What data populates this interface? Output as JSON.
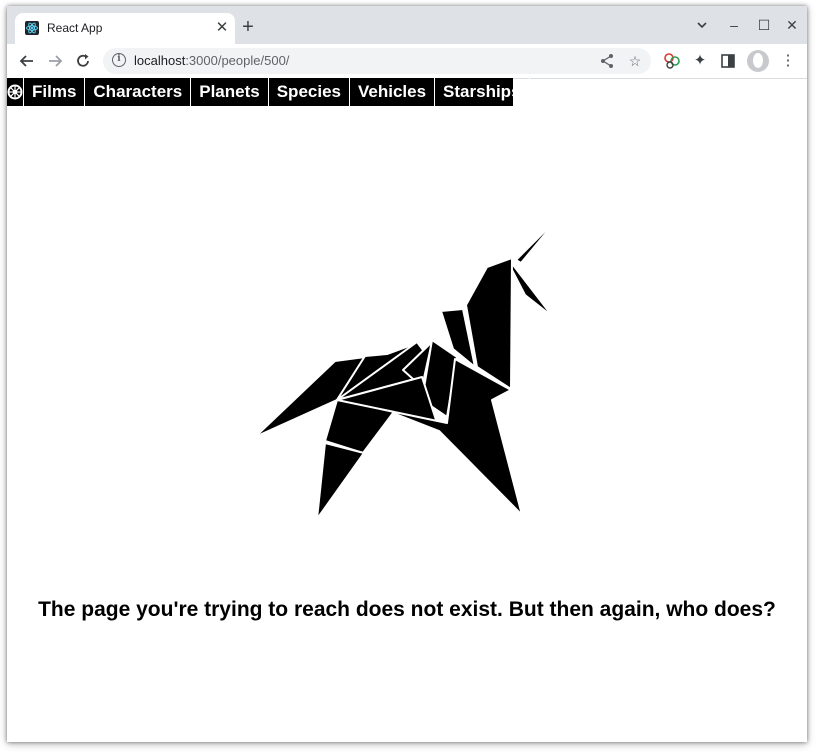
{
  "browser": {
    "tab": {
      "title": "React App",
      "favicon": "react-logo"
    },
    "url": {
      "host": "localhost",
      "path": ":3000/people/500/"
    },
    "controls": {
      "minimize": "–",
      "maximize": "☐",
      "close": "✕",
      "tab_close": "✕",
      "new_tab": "+"
    }
  },
  "nav": {
    "logo": "empire-logo",
    "items": [
      "Films",
      "Characters",
      "Planets",
      "Species",
      "Vehicles",
      "Starships"
    ]
  },
  "page": {
    "illustration": "origami-unicorn",
    "message": "The page you're trying to reach does not exist. But then again, who does?"
  }
}
